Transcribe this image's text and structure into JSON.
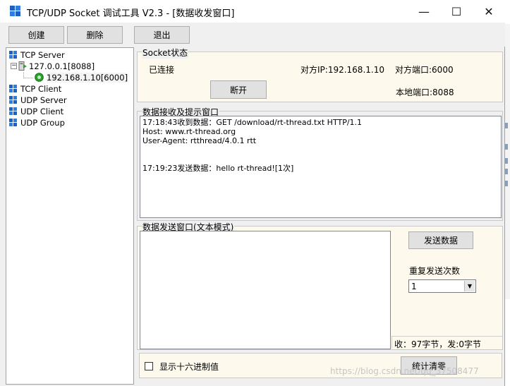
{
  "window": {
    "title": "TCP/UDP Socket 调试工具 V2.3 - [数据收发窗口]",
    "minimize_glyph": "—",
    "maximize_glyph": "☐",
    "close_glyph": "✕"
  },
  "toolbar": {
    "create_label": "创建",
    "delete_label": "删除",
    "exit_label": "退出"
  },
  "tree": {
    "tcp_server": "TCP Server",
    "server_node": "127.0.0.1[8088]",
    "client_node": "192.168.1.10[6000]",
    "tcp_client": "TCP Client",
    "udp_server": "UDP Server",
    "udp_client": "UDP Client",
    "udp_group": "UDP Group",
    "expander_glyph": "−"
  },
  "socket_status": {
    "group_title": "Socket状态",
    "status": "已连接",
    "remote_ip": "对方IP:192.168.1.10",
    "remote_port": "对方端口:6000",
    "local_port": "本地端口:8088",
    "disconnect_label": "断开"
  },
  "receive": {
    "group_title": "数据接收及提示窗口",
    "lines": [
      "17:18:43收到数据：GET /download/rt-thread.txt HTTP/1.1",
      "Host: www.rt-thread.org",
      "User-Agent: rtthread/4.0.1 rtt",
      "",
      "",
      "17:19:23发送数据：hello rt-thread![1次]"
    ]
  },
  "send": {
    "group_title": "数据发送窗口(文本模式)",
    "text": "",
    "send_button_label": "发送数据",
    "repeat_label": "重复发送次数",
    "repeat_value": "1",
    "stats": "收：97字节，发:0字节"
  },
  "bottom": {
    "hex_checkbox_label": "显示十六进制值",
    "hex_checked": false,
    "reset_stats_label": "统计清零",
    "watermark": "https://blog.csdn.net/qq_37508477"
  },
  "colors": {
    "panel_bg": "#f0f0f0",
    "cream_bg": "#fdf9ec",
    "button_bg": "#e1e1e1",
    "connection_icon": "#2fa02f"
  }
}
